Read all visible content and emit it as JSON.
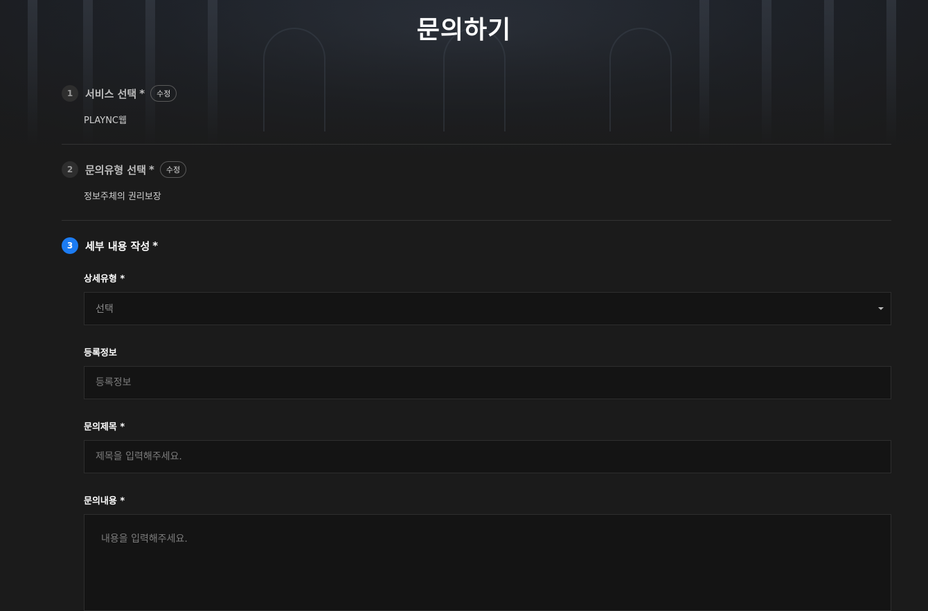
{
  "page": {
    "title": "문의하기"
  },
  "steps": [
    {
      "number": "1",
      "title": "서비스 선택",
      "required_mark": "*",
      "edit_label": "수정",
      "value": "PLAYNC웹"
    },
    {
      "number": "2",
      "title": "문의유형 선택",
      "required_mark": "*",
      "edit_label": "수정",
      "value": "정보주체의 권리보장"
    },
    {
      "number": "3",
      "title": "세부 내용 작성",
      "required_mark": "*"
    }
  ],
  "form": {
    "detail_type": {
      "label": "상세유형 *",
      "value": "선택"
    },
    "registration": {
      "label": "등록정보",
      "placeholder": "등록정보"
    },
    "subject": {
      "label": "문의제목 *",
      "placeholder": "제목을 입력해주세요."
    },
    "content": {
      "label": "문의내용 *",
      "placeholder": "내용을 입력해주세요."
    }
  },
  "colors": {
    "accent": "#1c7cf3",
    "background": "#1b1b1b"
  }
}
